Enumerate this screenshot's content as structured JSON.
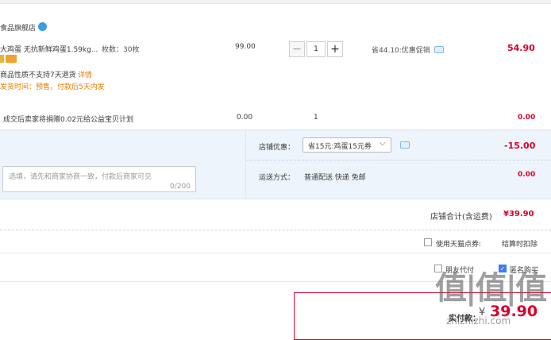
{
  "shop": {
    "name": "食品旗舰店",
    "icon": "shop-badge-icon"
  },
  "item": {
    "title": "大鸡蛋 无抗新鲜鸡蛋1.59kg...",
    "spec": "枚数：30枚",
    "unit_price": "99.00",
    "quantity": "1",
    "discount_note": "省44.10:优惠促销",
    "subtotal": "54.90",
    "return_note": "商品性质不支持7天退货",
    "return_link": "详情",
    "ship_note": "发货时间：预售，付款后5天内发"
  },
  "charity": {
    "text": "成交后卖家将捐赠0.02元给公益宝贝计划",
    "price": "0.00",
    "quantity": "1",
    "subtotal": "0.00"
  },
  "options": {
    "message_placeholder": "选填，请先和商家协商一致，付款后商家可见",
    "message_counter": "0/200",
    "coupon_label": "店铺优惠：",
    "coupon_selected": "省15元:鸡蛋15元券",
    "coupon_amount": "-15.00",
    "shipping_label": "运送方式：",
    "shipping_method": "普通配送 快递 免邮",
    "shipping_fee": "0.00"
  },
  "shop_total": {
    "label": "店铺合计(含运费)",
    "value": "¥39.90"
  },
  "points": {
    "label": "使用天猫点券:",
    "note": "结算时扣除"
  },
  "checkout_options": {
    "friend_pay": "朋友代付",
    "anonymous": "匿名购买"
  },
  "payment": {
    "label": "实付款：",
    "currency": "¥",
    "value": "39.90"
  },
  "watermark": {
    "mark": "值|值|值",
    "site": "zhizhizhi.com"
  },
  "colors": {
    "price_red": "#d9002a",
    "accent_blue": "#3a7cff",
    "panel_bg": "#eef4fb"
  }
}
